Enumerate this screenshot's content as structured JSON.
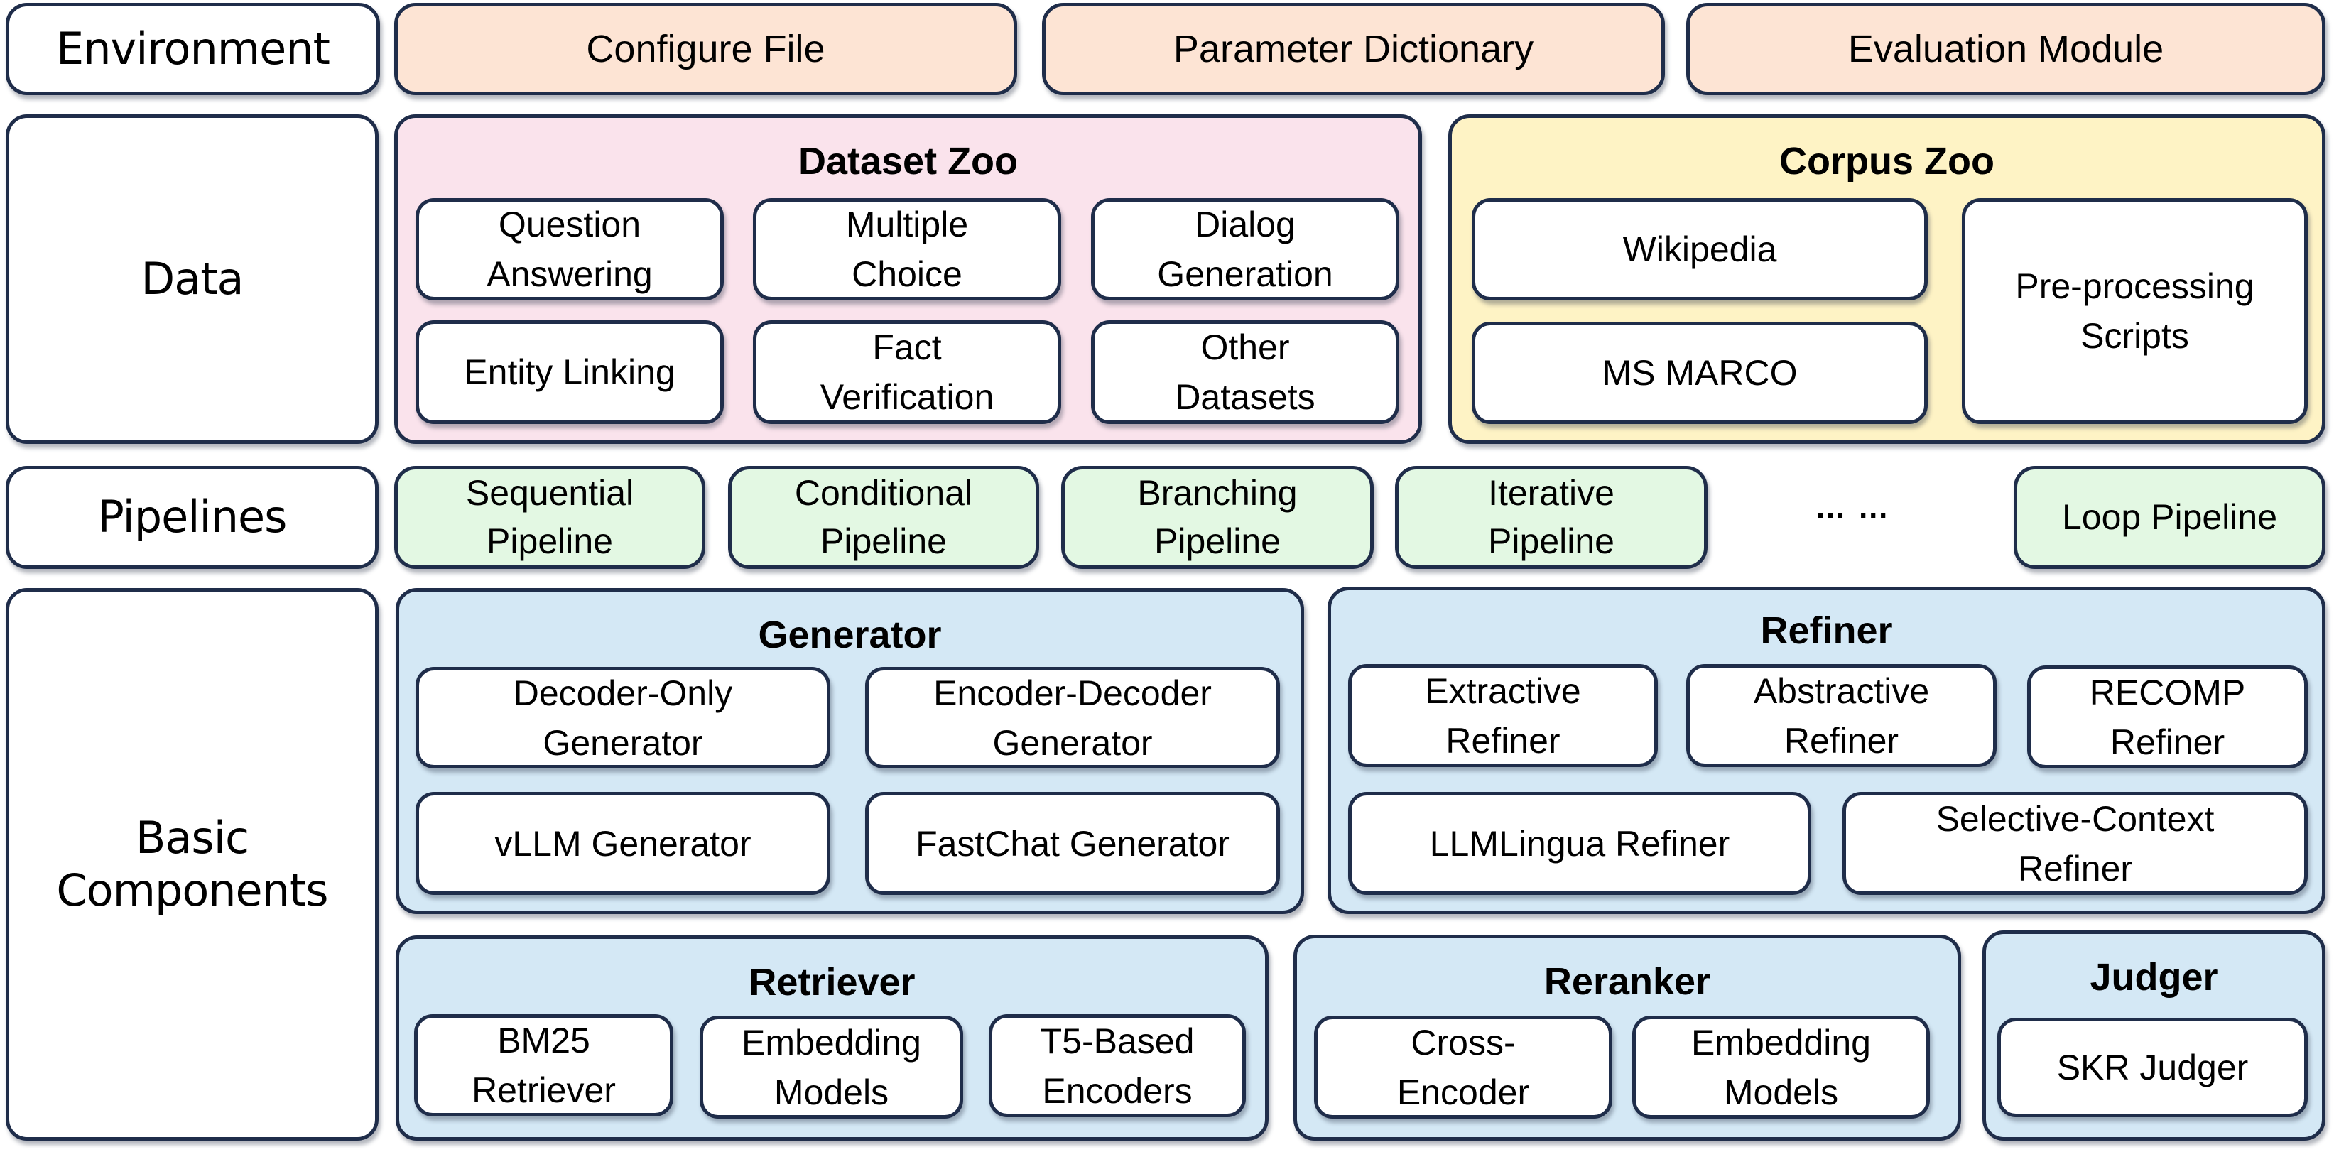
{
  "diagram": {
    "rows": [
      {
        "label": "Environment"
      },
      {
        "label": "Data"
      },
      {
        "label": "Pipelines"
      },
      {
        "label": "Basic\nComponents"
      }
    ],
    "environment": {
      "items": [
        "Configure File",
        "Parameter Dictionary",
        "Evaluation Module"
      ],
      "color": "#fde4d4"
    },
    "data": {
      "dataset_zoo": {
        "title": "Dataset Zoo",
        "color": "#fae3ec",
        "items": [
          "Question\nAnswering",
          "Multiple\nChoice",
          "Dialog\nGeneration",
          "Entity Linking",
          "Fact\nVerification",
          "Other\nDatasets"
        ]
      },
      "corpus_zoo": {
        "title": "Corpus Zoo",
        "color": "#fef3c5",
        "items": [
          "Wikipedia",
          "MS MARCO",
          "Pre-processing\nScripts"
        ]
      }
    },
    "pipelines": {
      "color": "#e3f8e3",
      "items": [
        "Sequential\nPipeline",
        "Conditional\nPipeline",
        "Branching\nPipeline",
        "Iterative\nPipeline",
        "Loop Pipeline"
      ],
      "ellipsis": "… …"
    },
    "components": {
      "color": "#d4e8f5",
      "generator": {
        "title": "Generator",
        "items": [
          "Decoder-Only\nGenerator",
          "Encoder-Decoder\nGenerator",
          "vLLM Generator",
          "FastChat Generator"
        ]
      },
      "refiner": {
        "title": "Refiner",
        "items": [
          "Extractive\nRefiner",
          "Abstractive\nRefiner",
          "RECOMP\nRefiner",
          "LLMLingua Refiner",
          "Selective-Context\nRefiner"
        ]
      },
      "retriever": {
        "title": "Retriever",
        "items": [
          "BM25\nRetriever",
          "Embedding\nModels",
          "T5-Based\nEncoders"
        ]
      },
      "reranker": {
        "title": "Reranker",
        "items": [
          "Cross-\nEncoder",
          "Embedding\nModels"
        ]
      },
      "judger": {
        "title": "Judger",
        "items": [
          "SKR Judger"
        ]
      }
    },
    "border_color": "#1f2d4a"
  }
}
